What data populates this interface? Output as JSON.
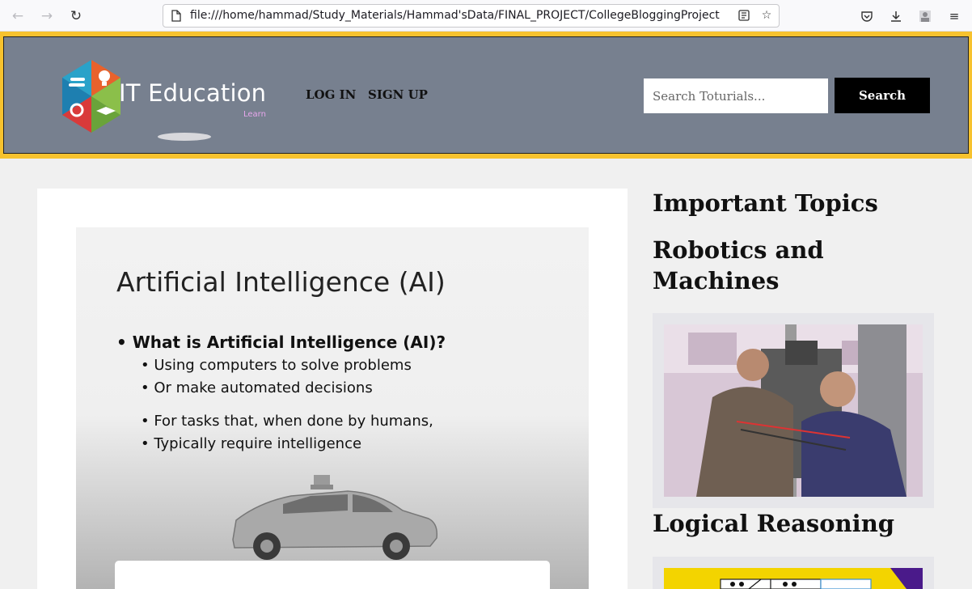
{
  "browser": {
    "url": "file:///home/hammad/Study_Materials/Hammad'sData/FINAL_PROJECT/CollegeBloggingProject",
    "back_icon": "arrow-left-icon",
    "forward_icon": "arrow-right-icon",
    "reload_icon": "reload-icon"
  },
  "header": {
    "logo_text": "IT Education",
    "logo_sub": "Learn",
    "nav": {
      "login": "LOG IN",
      "signup": "SIGN UP"
    },
    "search": {
      "placeholder": "Search Toturials...",
      "button": "Search"
    }
  },
  "main": {
    "slide": {
      "title": "Artificial Intelligence  (AI)",
      "bullets": [
        "• What is Artificial Intelligence (AI)?",
        "• Using computers to solve problems",
        "• Or make automated decisions",
        "• For tasks that, when done by humans,",
        "• Typically require intelligence"
      ]
    }
  },
  "sidebar": {
    "heading": "Important Topics",
    "topics": [
      {
        "title": "Robotics and Machines"
      },
      {
        "title": "Logical Reasoning"
      }
    ]
  },
  "colors": {
    "header_border": "#f7c22e",
    "header_bg": "#77808f",
    "search_button": "#000000"
  }
}
